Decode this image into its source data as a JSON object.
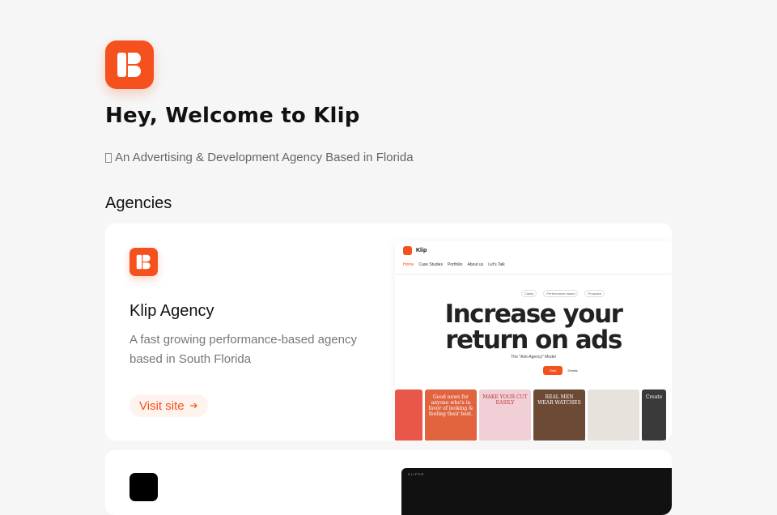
{
  "header": {
    "title": "Hey, Welcome to Klip",
    "subtitle": "An Advertising & Development Agency Based in Florida"
  },
  "section": {
    "title": "Agencies"
  },
  "agencies": [
    {
      "name": "Klip Agency",
      "description": "A fast growing performance-based agency based in South Florida",
      "visit_label": "Visit site",
      "preview": {
        "brand": "Klip",
        "nav": [
          "Home",
          "Case Studies",
          "Portfolio",
          "About us",
          "Let's Talk"
        ],
        "chips": [
          "Clarity",
          "Performance-based",
          "Proactive"
        ],
        "headline_line1": "Increase your",
        "headline_line2": "return on ads",
        "tagline": "The \"Anti-Agency\" Model",
        "primary_button": "Start",
        "secondary_button": "Details",
        "tiles": [
          {
            "text": "",
            "color": "#e9574a"
          },
          {
            "text": "Good news for anyone who's in favor of looking & feeling their best.",
            "color": "#e1643f"
          },
          {
            "text": "MAKE YOUR CUT EASILY",
            "color": "#f1cfd7"
          },
          {
            "text": "REAL MEN WEAR WATCHES",
            "color": "#6d4a36"
          },
          {
            "text": "",
            "color": "#e7e2dc"
          },
          {
            "text": "Create",
            "color": "#3a3a3a"
          }
        ]
      }
    },
    {
      "preview": {
        "brand": "KLIPSR"
      }
    }
  ],
  "colors": {
    "accent": "#f5511e",
    "background": "#f6f6f6",
    "card": "#ffffff"
  },
  "icons": {
    "logo": "klip-logo-icon",
    "visit_arrow": "arrow-right-icon"
  }
}
